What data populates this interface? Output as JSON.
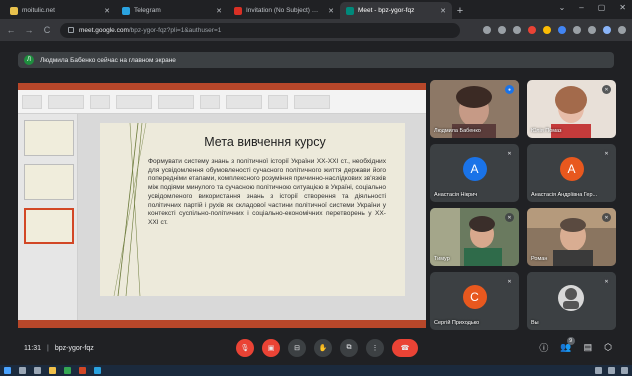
{
  "browser": {
    "tabs": [
      {
        "title": "moitulic.net",
        "color": "#e8c14c",
        "active": false
      },
      {
        "title": "Telegram",
        "color": "#2aa3e0",
        "active": false
      },
      {
        "title": "Invitation (No Subject) @ Tue Fe",
        "color": "#d93025",
        "active": false
      },
      {
        "title": "Meet - bpz-ygor-fqz",
        "color": "#00897b",
        "active": true
      }
    ],
    "url_host": "meet.google.com",
    "url_rest": "/bpz-ygor-fqz?pli=1&authuser=1"
  },
  "banner": {
    "avatar_letter": "Л",
    "text": "Людмила Бабенко сейчас на главном экране"
  },
  "presentation": {
    "slide_title": "Мета вивчення курсу",
    "slide_body": "Формувати систему знань з політичної історії України ХХ-ХХІ ст., необхідних для усвідомлення обумовленості сучасного політичного життя держави його попередніми етапами, комплексного розуміння причинно-наслідкових зв'язків між подіями минулого та сучасною політичною ситуацією в Україні, соціально усвідомленого використання знань з історії створення та діяльності політичних партій і рухів як складової частини політичної системи України у контексті суспільно-політичних і соціально-економічних перетворень у ХХ-ХХІ ст."
  },
  "participants": [
    {
      "name": "Людмила Бабенко",
      "type": "video",
      "bg": "#7d6a5c"
    },
    {
      "name": "Юлія Помаз",
      "type": "video",
      "bg": "#9b7b6c"
    },
    {
      "name": "Анастасія Нікрич",
      "type": "avatar",
      "letter": "A",
      "avatar_color": "#1a73e8"
    },
    {
      "name": "Анастасія Андріївна Гер...",
      "type": "avatar",
      "letter": "A",
      "avatar_color": "#e8581e"
    },
    {
      "name": "Тимур",
      "type": "video",
      "bg": "#6f7d6a"
    },
    {
      "name": "Роман",
      "type": "video",
      "bg": "#8c7a66"
    },
    {
      "name": "Сергій Приходько",
      "type": "avatar",
      "letter": "С",
      "avatar_color": "#e8581e"
    },
    {
      "name": "Вы",
      "type": "video",
      "bg": "#4a4d52"
    }
  ],
  "bottom": {
    "time": "11:31",
    "separator": "|",
    "code": "bpz-ygor-fqz",
    "people_count": "9"
  }
}
